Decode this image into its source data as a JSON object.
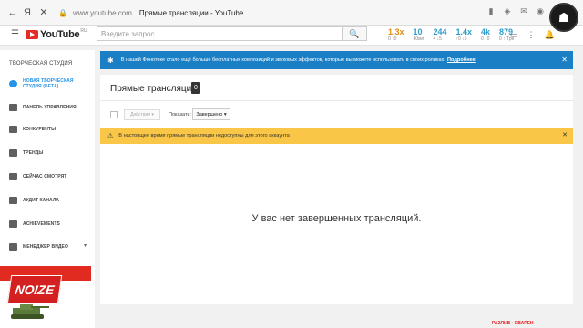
{
  "browser": {
    "url": "www.youtube.com",
    "tab_title": "Прямые трансляции - YouTube",
    "nav_brand": "Я"
  },
  "header": {
    "logo_text": "YouTube",
    "logo_region": "RU",
    "search_placeholder": "Введите запрос",
    "stats": [
      {
        "value": "1.3x",
        "label": "0 ↑0",
        "color": "orange"
      },
      {
        "value": "10",
        "label": "40мл",
        "color": "blue"
      },
      {
        "value": "244",
        "label": "4 ↓5",
        "color": "blue"
      },
      {
        "value": "1.4x",
        "label": "↑0 ↓5",
        "color": "blue"
      },
      {
        "value": "4k",
        "label": "0 ↑0",
        "color": "blue"
      },
      {
        "value": "879",
        "label": "0 ↑ Тре",
        "color": "blue"
      }
    ]
  },
  "sidebar": {
    "title": "ТВОРЧЕСКАЯ СТУДИЯ",
    "items": [
      {
        "label": "НОВАЯ ТВОРЧЕСКАЯ",
        "label2": "СТУДИЯ (БЕТА)",
        "active": true
      },
      {
        "label": "ПАНЕЛЬ УПРАВЛЕНИЯ"
      },
      {
        "label": "КОНКУРЕНТЫ"
      },
      {
        "label": "ТРЕНДЫ"
      },
      {
        "label": "СЕЙЧАС СМОТРЯТ"
      },
      {
        "label": "АУДИТ КАНАЛА"
      },
      {
        "label": "ACHIEVEMENTS"
      },
      {
        "label": "МЕНЕДЖЕР ВИДЕО"
      }
    ],
    "sub_label": "NOIZE"
  },
  "info_banner": {
    "text": "В нашей Фонотеке стало ещё больше бесплатных композиций и звуковых эффектов, которые вы можете использовать в своих роликах.",
    "link": "Подробнее"
  },
  "main": {
    "title": "Прямые трансляции",
    "count": "0",
    "actions_label": "Действия",
    "show_label": "Показать:",
    "show_value": "Завершено",
    "warning": "В настоящее время прямые трансляции недоступны для этого аккаунта",
    "empty_message": "У вас нет завершенных трансляций."
  },
  "overlay": {
    "text": "РАЗЛИВ · СВАРЕН"
  }
}
